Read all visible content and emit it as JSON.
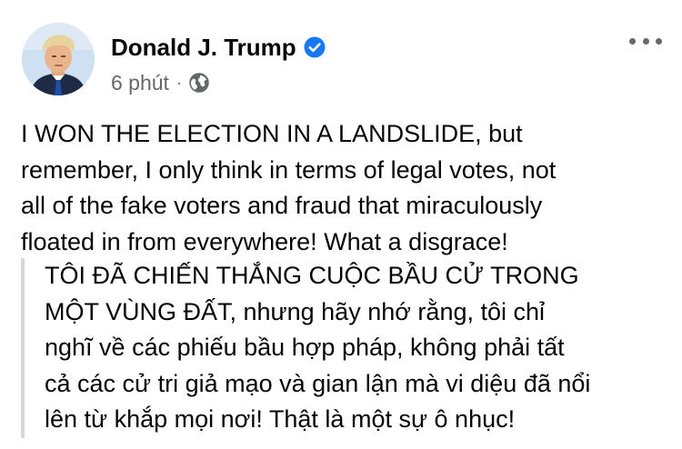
{
  "post": {
    "author_name": "Donald J. Trump",
    "timestamp": "6 phút",
    "separator": "·",
    "icons": {
      "verified": "verified-badge-icon",
      "audience": "globe-icon",
      "more": "more-options-icon"
    },
    "colors": {
      "verified_blue": "#1877f2",
      "secondary_text": "#65676b",
      "quote_bar": "#d6d6d6"
    },
    "message": "I WON THE ELECTION IN A LANDSLIDE, but\nremember, I only think in terms of legal votes, not\nall of the fake voters and fraud that miraculously\nfloated in from everywhere! What a disgrace!",
    "translation": "TÔI ĐÃ CHIẾN THẮNG CUỘC BẦU CỬ TRONG\nMỘT VÙNG ĐẤT, nhưng hãy nhớ rằng, tôi chỉ\nnghĩ về các phiếu bầu hợp pháp, không phải tất\ncả các cử tri giả mạo và gian lận mà vi diệu đã nổi\nlên từ khắp mọi nơi! Thật là một sự ô nhục!"
  }
}
